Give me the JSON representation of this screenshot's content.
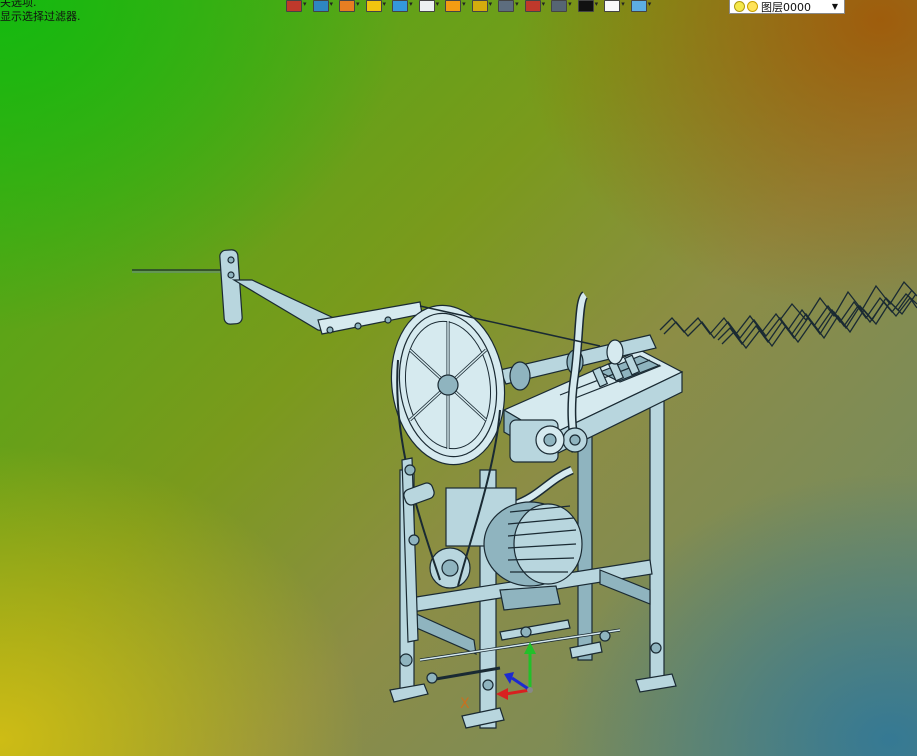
{
  "prompt": {
    "line1": "关选项.",
    "line2": "显示选择过滤器."
  },
  "toolbar": {
    "buttons": [
      {
        "icon": "sketch-icon",
        "color": "#c0392b"
      },
      {
        "icon": "view-orient-icon",
        "color": "#2e86c1"
      },
      {
        "icon": "pen-icon",
        "color": "#e67e22"
      },
      {
        "icon": "layer-stack-icon",
        "color": "#f1c40f"
      },
      {
        "icon": "box-blue-icon",
        "color": "#3498db"
      },
      {
        "icon": "box-white-icon",
        "color": "#ecf0f1"
      },
      {
        "icon": "orange-wheel-icon",
        "color": "#f39c12"
      },
      {
        "icon": "zoom-icon",
        "color": "#d4ac0d"
      },
      {
        "icon": "page-icon",
        "color": "#5d6d7e"
      },
      {
        "icon": "window-red-icon",
        "color": "#c0392b"
      },
      {
        "icon": "monitor-icon",
        "color": "#566573"
      },
      {
        "icon": "black-rect-icon",
        "color": "#111111"
      },
      {
        "icon": "white-page-icon",
        "color": "#f8f9f9"
      },
      {
        "icon": "blue-layers-icon",
        "color": "#5dade2"
      }
    ],
    "layer": {
      "label": "图层0000",
      "lamp_icon": "light-bulb-icon",
      "status_icon": "sun-icon",
      "dropdown_icon": "chevron-down-icon"
    }
  },
  "viewport": {
    "triad_label": "X",
    "model_name": "cad-machine-assembly"
  }
}
